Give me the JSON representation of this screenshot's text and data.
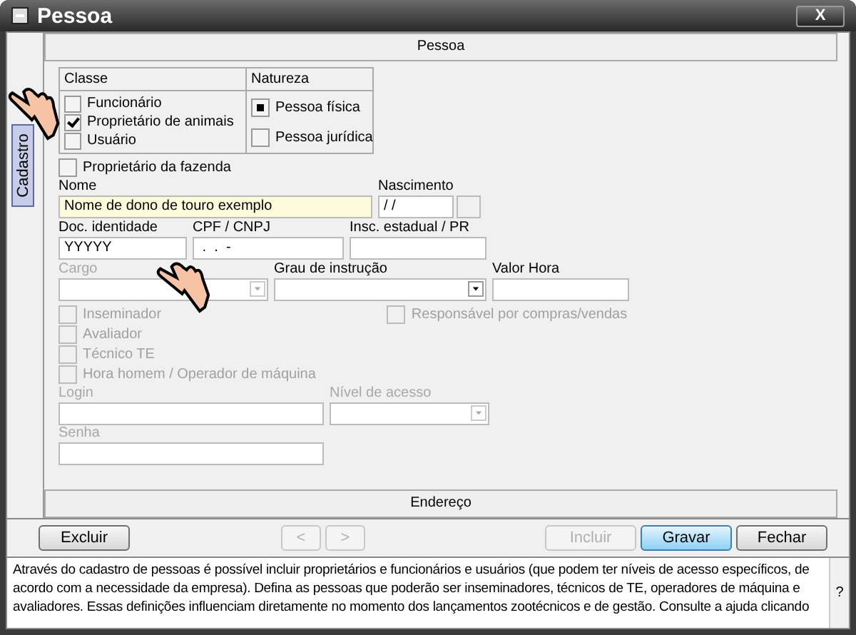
{
  "window": {
    "title": "Pessoa",
    "close": "X"
  },
  "side_tab": {
    "label": "Cadastro",
    "selected": true
  },
  "header": "Pessoa",
  "classe": {
    "title": "Classe",
    "items": [
      {
        "label": "Funcionário",
        "checked": false
      },
      {
        "label": "Proprietário de animais",
        "checked": true
      },
      {
        "label": "Usuário",
        "checked": false
      }
    ]
  },
  "natureza": {
    "title": "Natureza",
    "items": [
      {
        "label": "Pessoa física",
        "selected": true
      },
      {
        "label": "Pessoa jurídica",
        "selected": false
      }
    ]
  },
  "proprietario_fazenda": {
    "label": "Proprietário da fazenda",
    "checked": false
  },
  "nome": {
    "label": "Nome",
    "value": "Nome de dono de touro exemplo"
  },
  "nascimento": {
    "label": "Nascimento",
    "value": " / /"
  },
  "doc_identidade": {
    "label": "Doc. identidade",
    "value": "YYYYY"
  },
  "cpf_cnpj": {
    "label": "CPF / CNPJ",
    "value": " .  .  -"
  },
  "insc_estadual": {
    "label": "Insc. estadual / PR"
  },
  "cargo": {
    "label": "Cargo",
    "disabled": true
  },
  "grau_instrucao": {
    "label": "Grau de instrução",
    "disabled": false
  },
  "valor_hora": {
    "label": "Valor Hora"
  },
  "roles": [
    {
      "label": "Inseminador",
      "checked": false,
      "disabled": true
    },
    {
      "label": "Avaliador",
      "checked": false,
      "disabled": true
    },
    {
      "label": "Técnico TE",
      "checked": false,
      "disabled": true
    },
    {
      "label": "Hora homem / Operador de máquina",
      "checked": false,
      "disabled": true
    }
  ],
  "responsavel": {
    "label": "Responsável por compras/vendas",
    "checked": false,
    "disabled": true
  },
  "login": {
    "label": "Login",
    "disabled": true
  },
  "nivel_acesso": {
    "label": "Nível de acesso",
    "disabled": true
  },
  "senha": {
    "label": "Senha",
    "disabled": true
  },
  "footer_tab": "Endereço",
  "buttons": [
    {
      "label": "Excluir",
      "disabled": false,
      "default": false
    },
    {
      "label": "<",
      "disabled": true,
      "default": false
    },
    {
      "label": ">",
      "disabled": true,
      "default": false
    },
    {
      "label": "Incluir",
      "disabled": true,
      "default": false
    },
    {
      "label": "Gravar",
      "disabled": false,
      "default": true
    },
    {
      "label": "Fechar",
      "disabled": false,
      "default": false
    }
  ],
  "help_text": "Através do cadastro de pessoas é possível incluir proprietários e funcionários e usuários (que podem ter níveis de acesso específicos, de acordo com a necessidade da empresa). Defina as pessoas que poderão ser inseminadores, técnicos de TE, operadores de máquina e avaliadores. Essas definições influenciam diretamente no momento dos lançamentos zootécnicos e de gestão. Consulte a ajuda clicando",
  "help_button": "?"
}
